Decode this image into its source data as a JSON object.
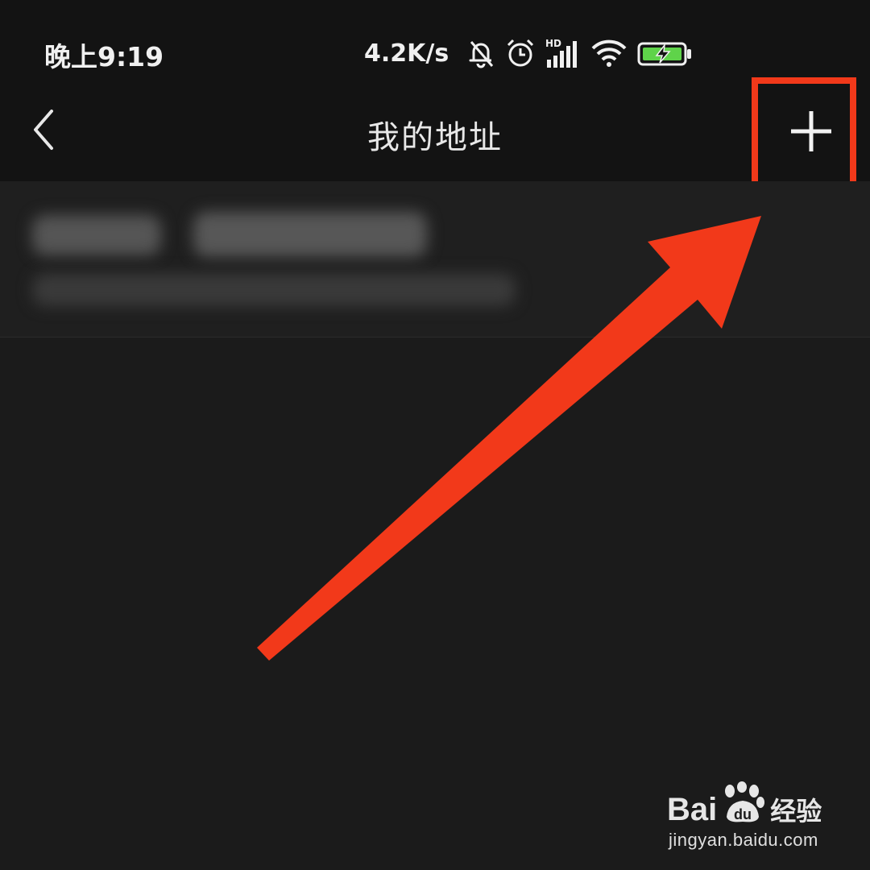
{
  "status_bar": {
    "time": "晚上9:19",
    "net_speed": "4.2K/s",
    "signal_label": "HD",
    "icons": [
      "bell-off-icon",
      "alarm-icon",
      "signal-icon",
      "wifi-icon",
      "battery-charging-icon"
    ],
    "battery_color": "#5fd34a"
  },
  "nav": {
    "back_icon": "chevron-left-icon",
    "title": "我的地址",
    "add_icon": "plus-icon"
  },
  "address_list": {
    "items": [
      {
        "name": "████",
        "phone": "███████████",
        "address": "████████████████████████"
      }
    ]
  },
  "annotation": {
    "color": "#f2391a",
    "target": "add-button"
  },
  "watermark": {
    "brand": "Baidu",
    "brand_part1": "Bai",
    "brand_part2": "du",
    "product": "经验",
    "url": "jingyan.baidu.com"
  }
}
